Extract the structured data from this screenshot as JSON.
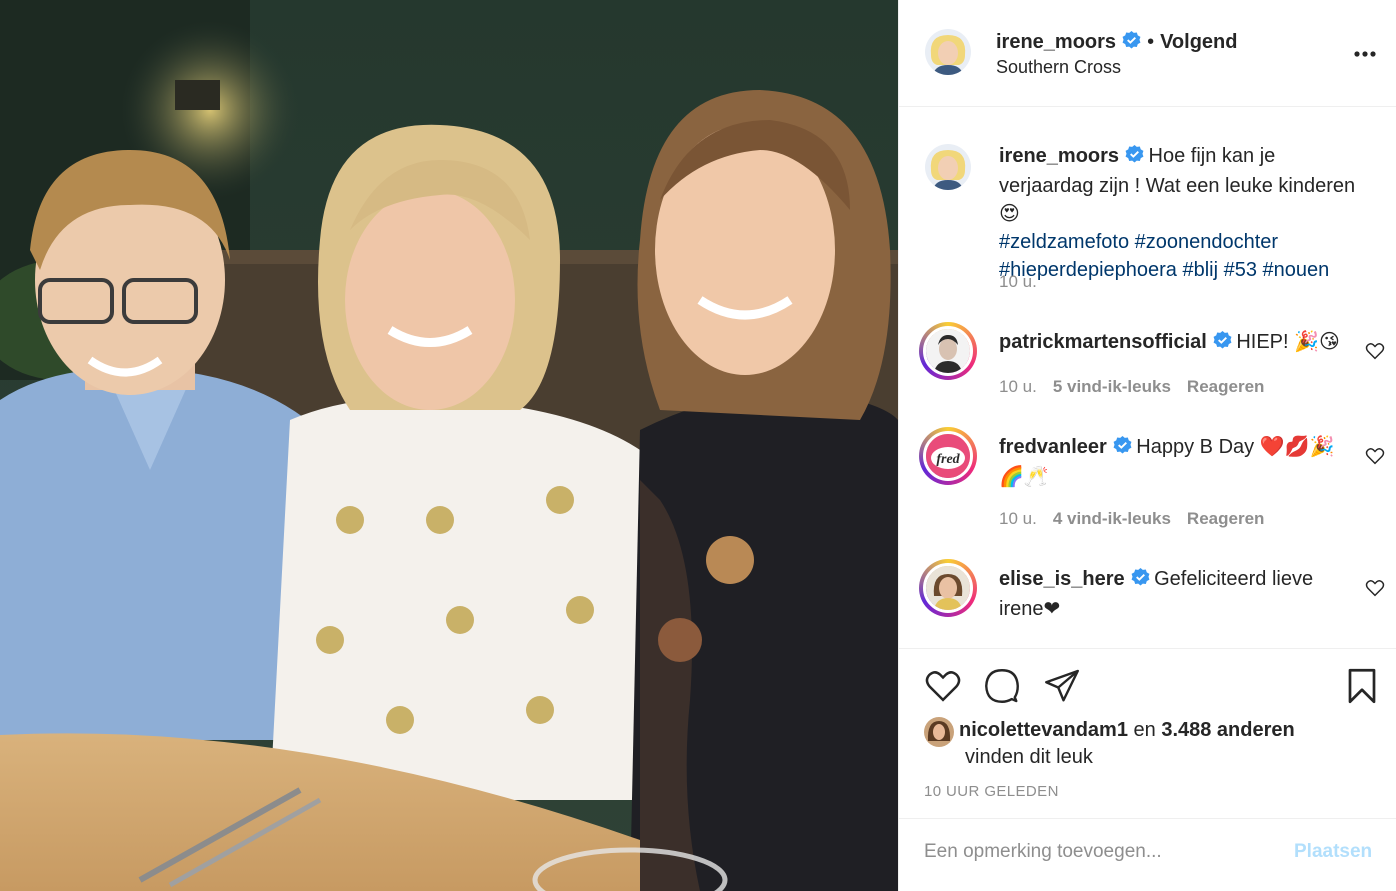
{
  "post": {
    "photo_description_icon": "group-photo"
  },
  "header": {
    "username": "irene_moors",
    "separator": "•",
    "follow_label": "Volgend",
    "location": "Southern Cross",
    "more_icon": "more-icon"
  },
  "caption": {
    "username": "irene_moors",
    "text": "Hoe fijn kan je verjaardag zijn ! Wat een leuke kinderen 😍",
    "hashtags_line1": "#zeldzamefoto #zoonendochter",
    "hashtags_line2": "#hieperdepiephoera #blij #53 #nouen",
    "time": "10 u."
  },
  "comments": [
    {
      "username": "patrickmartensofficial",
      "text": "HIEP! 🎉😘",
      "time": "10 u.",
      "likes": "5 vind-ik-leuks",
      "reply": "Reageren"
    },
    {
      "username": "fredvanleer",
      "text": "Happy B Day ❤️💋🎉",
      "text2": "🌈🥂",
      "time": "10 u.",
      "likes": "4 vind-ik-leuks",
      "reply": "Reageren"
    },
    {
      "username": "elise_is_here",
      "text": "Gefeliciteerd lieve",
      "text2": "irene❤"
    }
  ],
  "likes": {
    "user": "nicolettevandam1",
    "conj": "en",
    "others": "3.488 anderen",
    "suffix": "vinden dit leuk"
  },
  "time_caps": "10 UUR GELEDEN",
  "add_comment": {
    "placeholder": "Een opmerking toevoegen...",
    "post_label": "Plaatsen"
  },
  "colors": {
    "verified": "#3897f0",
    "link": "#00376b",
    "muted": "#8e8e8e",
    "post_disabled": "#b2dffc"
  }
}
